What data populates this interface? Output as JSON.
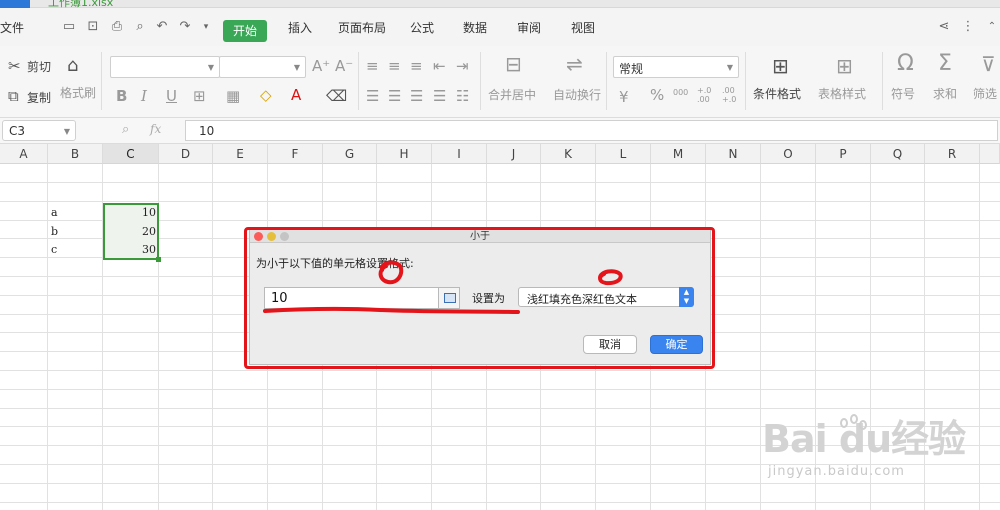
{
  "titlebar": {
    "tab_hint": "工作簿1.xlsx"
  },
  "menu": {
    "file": "文件",
    "tabs": [
      "开始",
      "插入",
      "页面布局",
      "公式",
      "数据",
      "审阅",
      "视图"
    ]
  },
  "ribbon": {
    "cut": "剪切",
    "copy": "复制",
    "format_painter": "格式刷",
    "font_grow": "A⁺",
    "font_shrink": "A⁻",
    "number_format": "常规",
    "merge_center": "合并居中",
    "wrap_text": "自动换行",
    "conditional_format": "条件格式",
    "table_style": "表格样式",
    "symbol": "符号",
    "sum": "求和",
    "filter": "筛选",
    "percent": "%",
    "thousands": "000",
    "inc_decimal": "+.0\n.00",
    "dec_decimal": ".00\n+.0"
  },
  "formula_bar": {
    "name_box": "C3",
    "fx": "fx",
    "value": "10"
  },
  "columns": [
    "A",
    "B",
    "C",
    "D",
    "E",
    "F",
    "G",
    "H",
    "I",
    "J",
    "K",
    "L",
    "M",
    "N",
    "O",
    "P",
    "Q",
    "R"
  ],
  "cells": {
    "b3": "a",
    "b4": "b",
    "b5": "c",
    "c3": "10",
    "c4": "20",
    "c5": "30"
  },
  "dialog": {
    "title": "小于",
    "prompt": "为小于以下值的单元格设置格式:",
    "value": "10",
    "set_as_label": "设置为",
    "format_option": "浅红填充色深红色文本",
    "cancel": "取消",
    "ok": "确定"
  },
  "watermark": {
    "brand": "Bai du经验",
    "url": "jingyan.baidu.com"
  },
  "colors": {
    "accent_green": "#3aa757",
    "dialog_blue": "#3a84f0",
    "annotation_red": "#e4141b"
  }
}
